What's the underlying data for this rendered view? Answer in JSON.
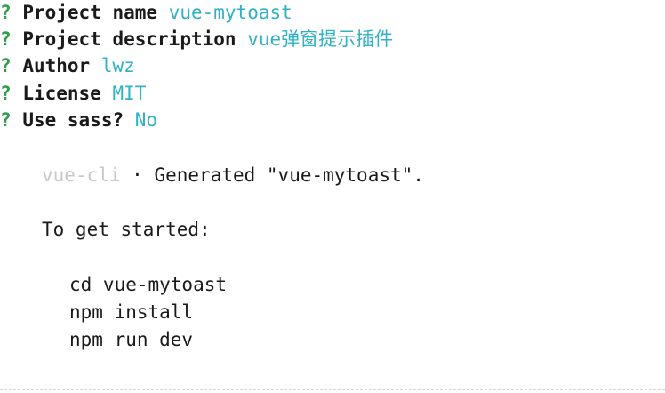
{
  "colors": {
    "question_mark": "#2e9e4a",
    "answer": "#2fb3c4",
    "dim": "#c8c8c8",
    "text": "#1a1a1a"
  },
  "prompts": [
    {
      "mark": "?",
      "label": "Project name",
      "answer": "vue-mytoast"
    },
    {
      "mark": "?",
      "label": "Project description",
      "answer": "vue弹窗提示插件"
    },
    {
      "mark": "?",
      "label": "Author",
      "answer": "lwz"
    },
    {
      "mark": "?",
      "label": "License",
      "answer": "MIT"
    },
    {
      "mark": "?",
      "label": "Use sass?",
      "answer": "No"
    }
  ],
  "generated": {
    "tool": "vue-cli",
    "separator": "·",
    "message": "Generated \"vue-mytoast\"."
  },
  "instructions": {
    "heading": "To get started:",
    "commands": [
      "cd vue-mytoast",
      "npm install",
      "npm run dev"
    ]
  }
}
